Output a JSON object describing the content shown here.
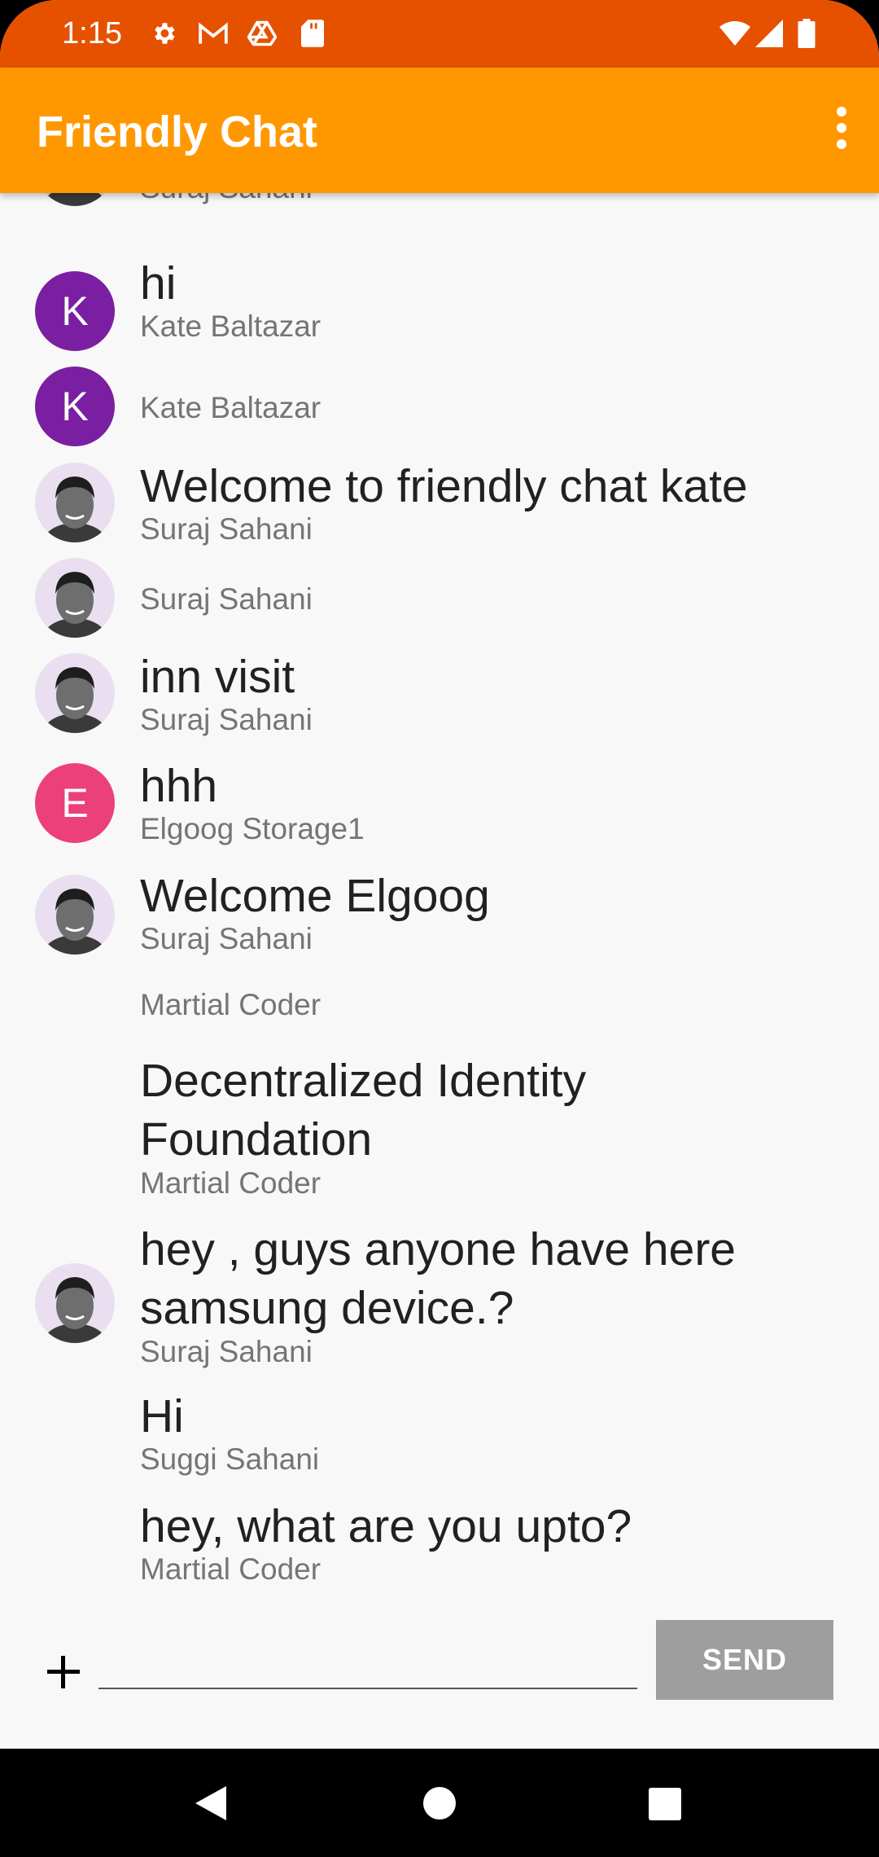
{
  "status_bar": {
    "time": "1:15"
  },
  "app_bar": {
    "title": "Friendly Chat"
  },
  "messages": [
    {
      "author": "Suraj Sahani"
    },
    {
      "text": "hi",
      "author": "Kate Baltazar",
      "avatar_letter": "K",
      "avatar_color": "#7B1FA2"
    },
    {
      "author": "Kate Baltazar",
      "avatar_letter": "K",
      "avatar_color": "#7B1FA2"
    },
    {
      "text": "Welcome to friendly chat kate",
      "author": "Suraj Sahani"
    },
    {
      "author": "Suraj Sahani"
    },
    {
      "text": "inn visit",
      "author": "Suraj Sahani"
    },
    {
      "text": "hhh",
      "author": "Elgoog Storage1",
      "avatar_letter": "E",
      "avatar_color": "#EC407A"
    },
    {
      "text": "Welcome Elgoog",
      "author": "Suraj Sahani"
    },
    {
      "author": "Martial Coder"
    },
    {
      "text": "Decentralized Identity Foundation",
      "author": "Martial Coder"
    },
    {
      "text": "hey , guys anyone have here samsung device.?",
      "author": "Suraj Sahani"
    },
    {
      "text": "Hi",
      "author": "Suggi Sahani"
    },
    {
      "text": "hey, what are you upto?",
      "author": "Martial Coder"
    }
  ],
  "composer": {
    "input_value": "",
    "send_label": "SEND"
  },
  "colors": {
    "status_bar": "#E65100",
    "app_bar": "#FF9800",
    "send_button": "#9E9E9E"
  }
}
